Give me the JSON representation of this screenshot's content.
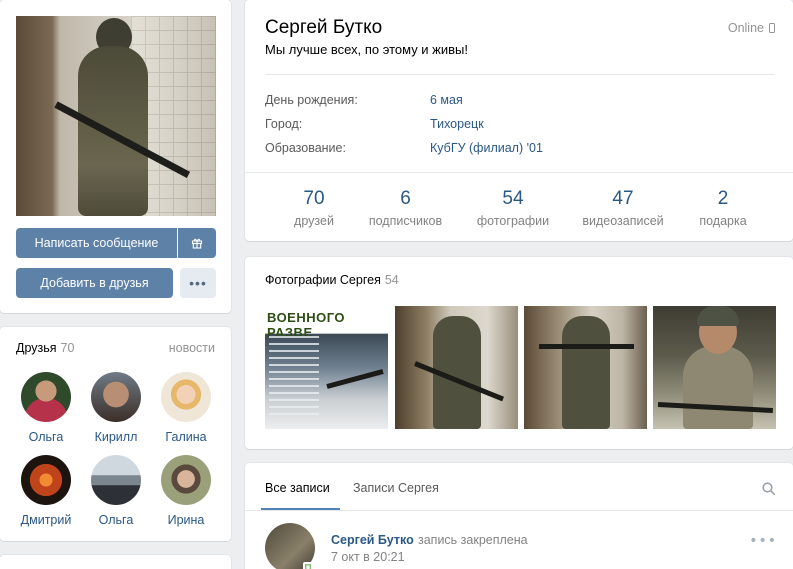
{
  "profile": {
    "name": "Сергей Бутко",
    "status": "Мы лучше всех, по этому и живы!",
    "online": "Online",
    "info": [
      {
        "label": "День рождения:",
        "value": "6 мая"
      },
      {
        "label": "Город:",
        "value": "Тихорецк"
      },
      {
        "label": "Образование:",
        "value": "КубГУ (филиал) '01"
      }
    ],
    "counters": [
      {
        "num": "70",
        "caption": "друзей"
      },
      {
        "num": "6",
        "caption": "подписчиков"
      },
      {
        "num": "54",
        "caption": "фотографии"
      },
      {
        "num": "47",
        "caption": "видеозаписей"
      },
      {
        "num": "2",
        "caption": "подарка"
      }
    ]
  },
  "actions": {
    "message": "Написать сообщение",
    "add_friend": "Добавить в друзья",
    "more": "•••"
  },
  "friends": {
    "title": "Друзья",
    "count": "70",
    "news_link": "новости",
    "items": [
      {
        "name": "Ольга",
        "color_a": "#2e4a2a",
        "color_b": "#b5324a"
      },
      {
        "name": "Кирилл",
        "color_a": "#b88f74",
        "color_b": "#3b2e28"
      },
      {
        "name": "Галина",
        "color_a": "#f0e6d8",
        "color_b": "#e7b86a"
      },
      {
        "name": "Дмитрий",
        "color_a": "#c0441b",
        "color_b": "#1d1410"
      },
      {
        "name": "Ольга",
        "color_a": "#cfd8df",
        "color_b": "#2d3036"
      },
      {
        "name": "Ирина",
        "color_a": "#9aa17a",
        "color_b": "#5a4a3e"
      }
    ]
  },
  "photos": {
    "title": "Фотографии Сергея",
    "count": "54",
    "thumb1_banner": "ВОЕННОГО РАЗВЕ"
  },
  "wall": {
    "tab_all": "Все записи",
    "tab_own": "Записи Сергея",
    "post": {
      "author": "Сергей Бутко",
      "pinned": "запись закреплена",
      "date": "7 окт в 20:21",
      "more": "•••"
    }
  }
}
